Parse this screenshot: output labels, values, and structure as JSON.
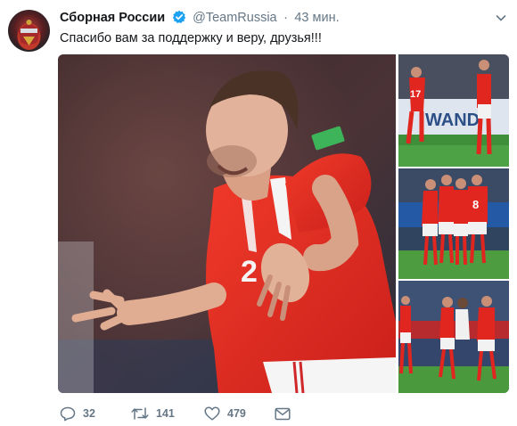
{
  "tweet": {
    "author_name": "Сборная России",
    "handle": "@TeamRussia",
    "separator": "·",
    "time": "43 мин.",
    "text": "Спасибо вам за поддержку и веру, друзья!!!",
    "verified": true
  },
  "photo_texts": {
    "jersey_number_main": "2",
    "jersey_number_t1": "17",
    "banner_t1": "WAND",
    "jersey_number_t2": "8"
  },
  "actions": {
    "reply_count": "32",
    "retweet_count": "141",
    "like_count": "479"
  },
  "icons": {
    "verified": "verified-badge-icon",
    "caret": "chevron-down-icon",
    "reply": "reply-icon",
    "retweet": "retweet-icon",
    "like": "heart-icon",
    "dm": "envelope-icon"
  },
  "colors": {
    "accent": "#1da1f2",
    "secondary_text": "#657786",
    "kit_red": "#e0261f"
  }
}
